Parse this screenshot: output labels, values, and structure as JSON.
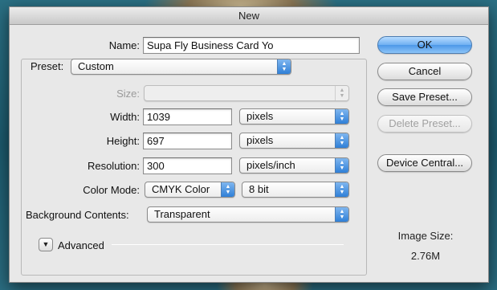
{
  "window": {
    "title": "New"
  },
  "name": {
    "label": "Name:",
    "value": "Supa Fly Business Card Yo"
  },
  "preset": {
    "label": "Preset:",
    "value": "Custom"
  },
  "size": {
    "label": "Size:",
    "value": ""
  },
  "width": {
    "label": "Width:",
    "value": "1039",
    "unit": "pixels"
  },
  "height": {
    "label": "Height:",
    "value": "697",
    "unit": "pixels"
  },
  "resolution": {
    "label": "Resolution:",
    "value": "300",
    "unit": "pixels/inch"
  },
  "color_mode": {
    "label": "Color Mode:",
    "value": "CMYK Color",
    "depth": "8 bit"
  },
  "background": {
    "label": "Background Contents:",
    "value": "Transparent"
  },
  "advanced": {
    "label": "Advanced",
    "icon": "disclosure-triangle-down-icon"
  },
  "buttons": {
    "ok": "OK",
    "cancel": "Cancel",
    "save_preset": "Save Preset...",
    "delete_preset": "Delete Preset...",
    "device_central": "Device Central..."
  },
  "image_size": {
    "label": "Image Size:",
    "value": "2.76M"
  },
  "colors": {
    "accent": "#4d98e8",
    "dialog_bg": "#e8e8e8",
    "disabled_text": "#9a9a9a"
  }
}
